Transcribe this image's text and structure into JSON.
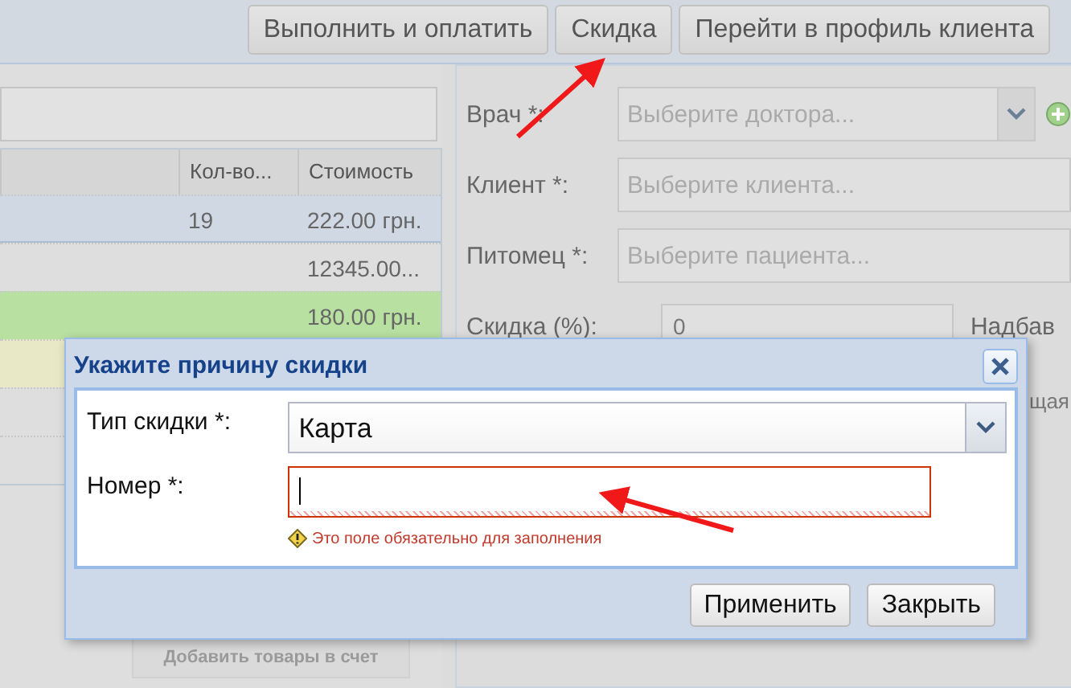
{
  "toolbar": {
    "buttons": [
      "Выполнить и оплатить",
      "Скидка",
      "Перейти в профиль клиента"
    ]
  },
  "items_grid": {
    "columns": [
      "Кол-во...",
      "Стоимость"
    ],
    "rows": [
      {
        "quantity": "19",
        "cost": "222.00 грн.",
        "selected": true
      },
      {
        "cost": "12345.00...",
        "selected": false,
        "color": "#dedede"
      },
      {
        "cost": "180.00 грн.",
        "selected": false,
        "color": "#b8e0a0"
      },
      {
        "selected": false,
        "color": "#e8e8c6"
      },
      {
        "selected": false,
        "color": "#dedede"
      },
      {
        "selected": false,
        "color": "#dedede"
      }
    ],
    "add_button": "Добавить товары в счет"
  },
  "form": {
    "fields": [
      {
        "label": "Врач *:",
        "placeholder": "Выберите доктора...",
        "kind": "combo"
      },
      {
        "label": "Клиент *:",
        "placeholder": "Выберите клиента...",
        "kind": "text"
      },
      {
        "label": "Питомец *:",
        "placeholder": "Выберите пациента...",
        "kind": "text"
      }
    ],
    "discount_label": "Скидка (%):",
    "discount_value": "0",
    "markup_label": "Надбав",
    "total_label_fragment": "щая"
  },
  "dialog": {
    "title": "Укажите причину скидки",
    "discount_type": {
      "label": "Тип скидки *:",
      "value": "Карта"
    },
    "number": {
      "label": "Номер *:",
      "invalid": true,
      "error": "Это поле обязательно для заполнения"
    },
    "buttons": [
      "Применить",
      "Закрыть"
    ]
  }
}
